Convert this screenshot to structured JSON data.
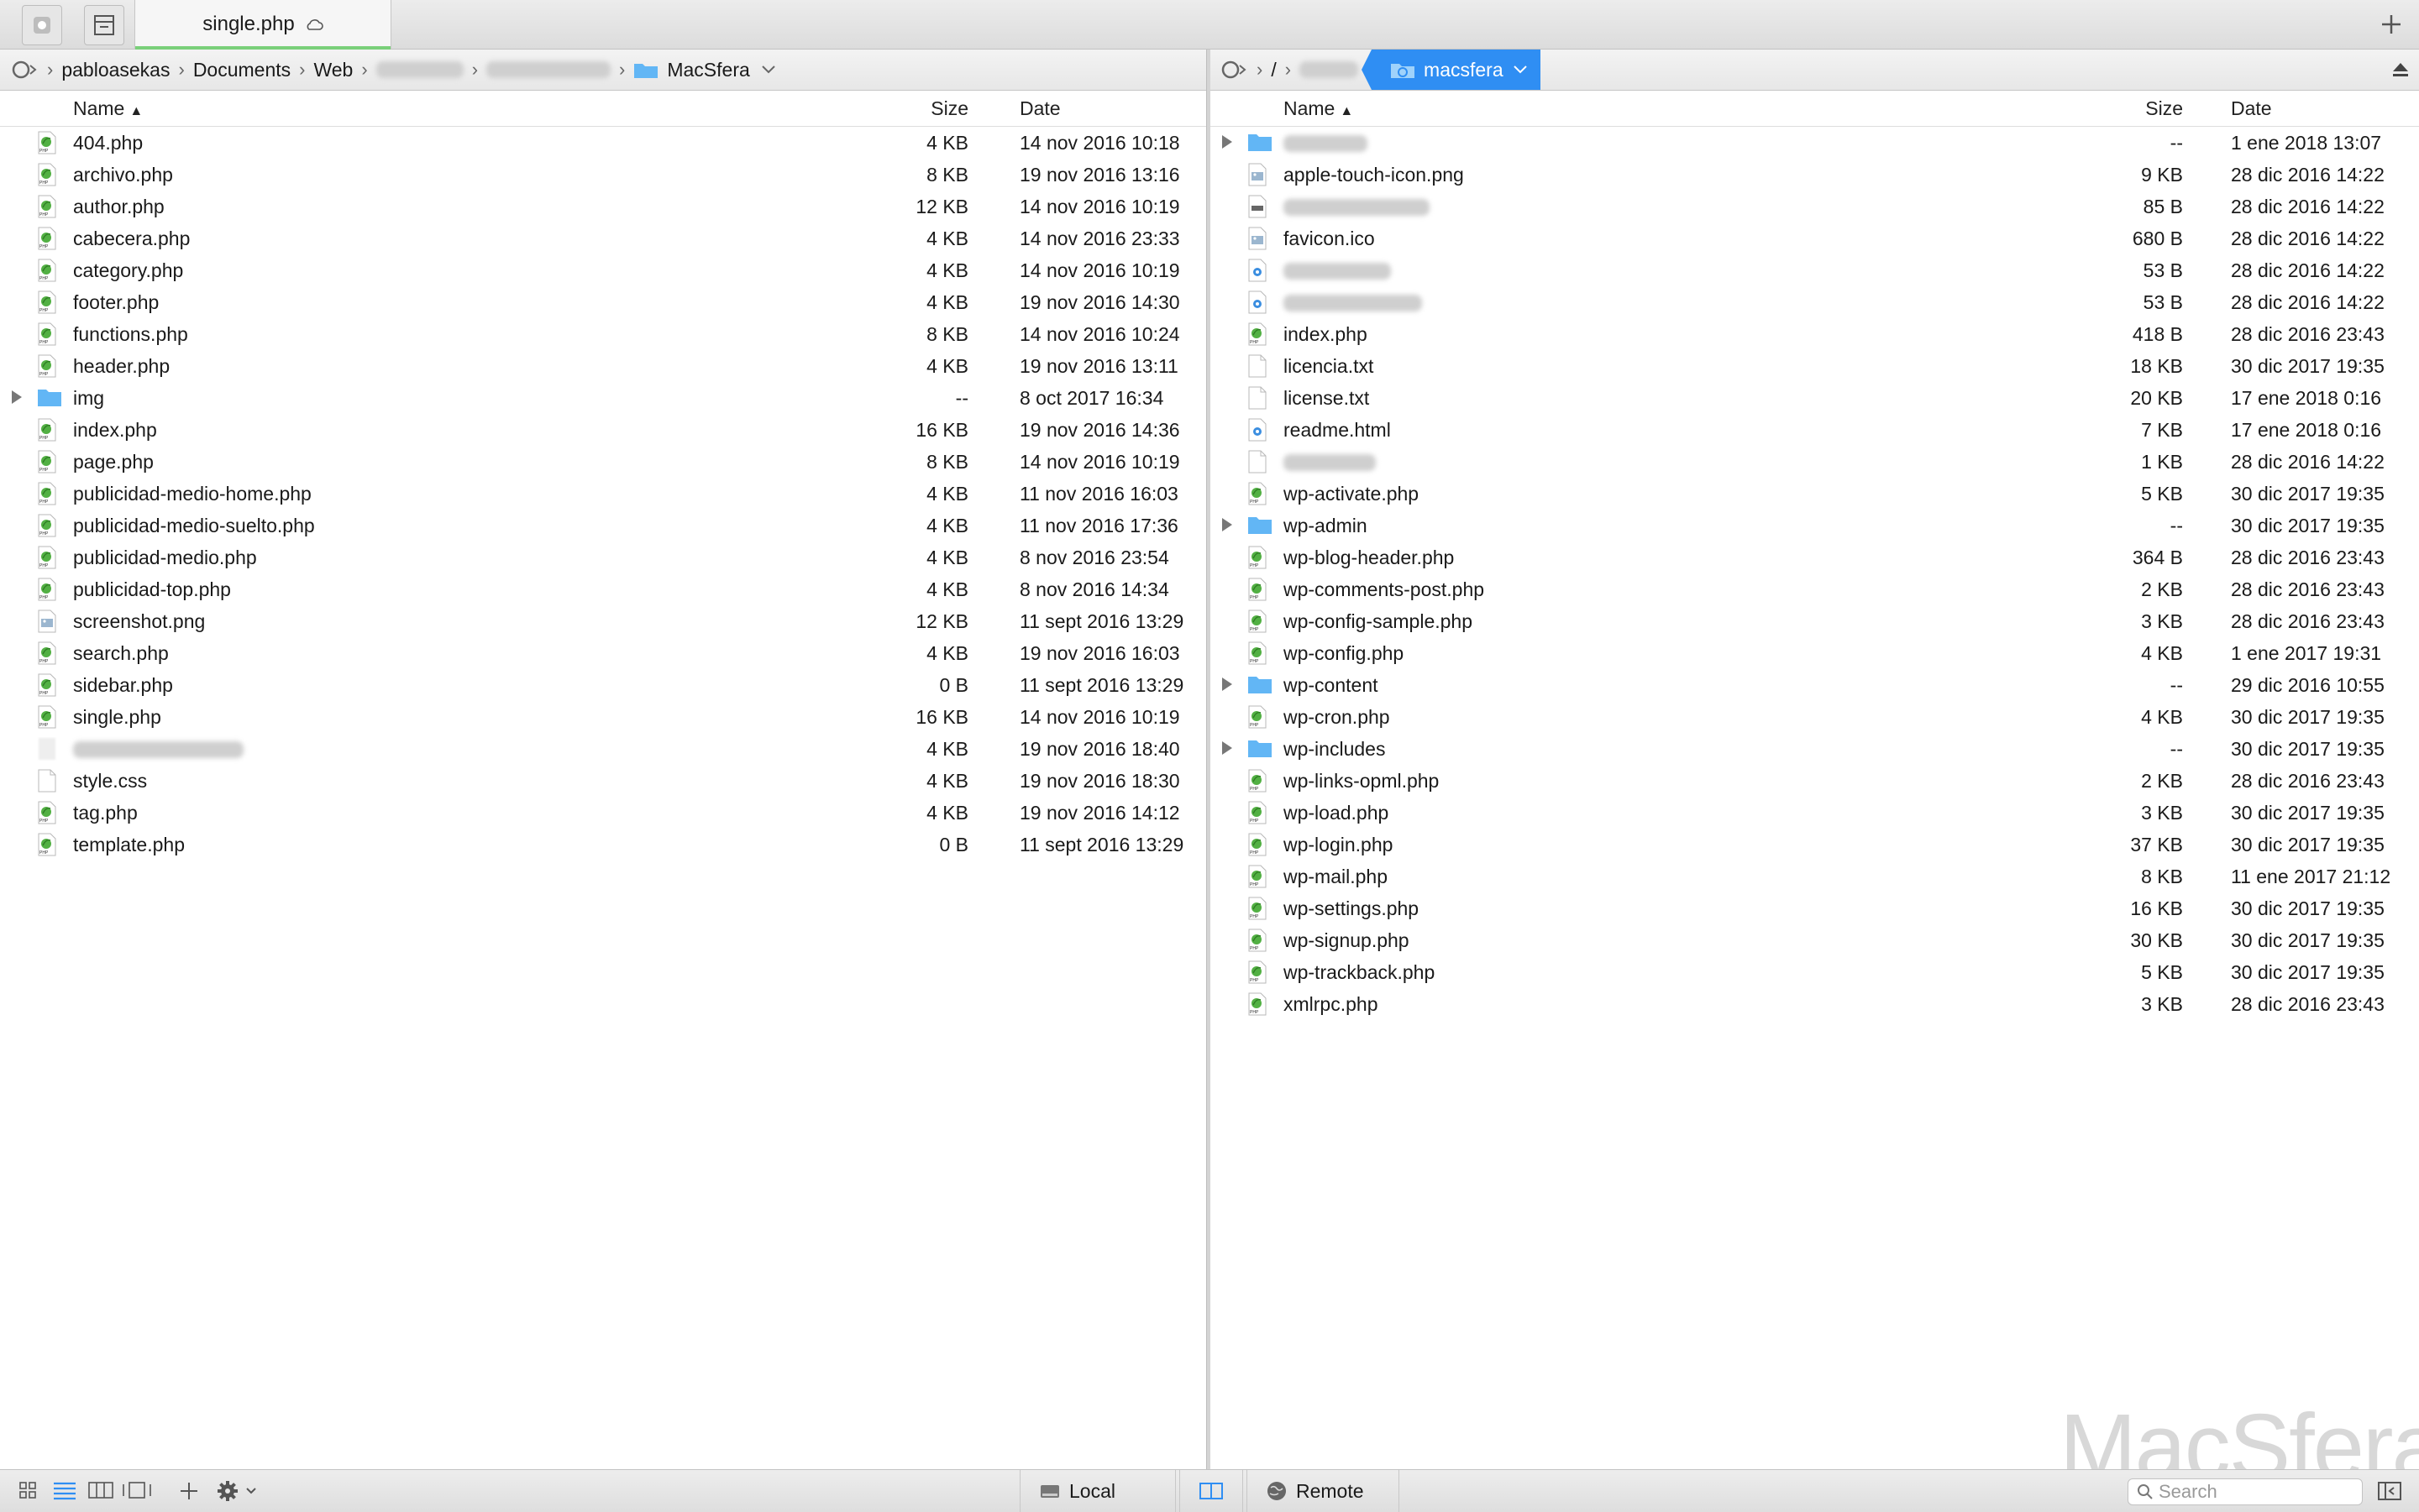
{
  "tab": {
    "title": "single.php"
  },
  "left_path": {
    "crumbs": [
      "pabloasekas",
      "Documents",
      "Web"
    ],
    "folder": "MacSfera"
  },
  "right_path": {
    "root": "/",
    "folder": "macsfera"
  },
  "columns": {
    "name": "Name",
    "size": "Size",
    "date": "Date"
  },
  "left_files": [
    {
      "name": "404.php",
      "size": "4 KB",
      "date": "14 nov 2016 10:18",
      "type": "php"
    },
    {
      "name": "archivo.php",
      "size": "8 KB",
      "date": "19 nov 2016 13:16",
      "type": "php"
    },
    {
      "name": "author.php",
      "size": "12 KB",
      "date": "14 nov 2016 10:19",
      "type": "php"
    },
    {
      "name": "cabecera.php",
      "size": "4 KB",
      "date": "14 nov 2016 23:33",
      "type": "php"
    },
    {
      "name": "category.php",
      "size": "4 KB",
      "date": "14 nov 2016 10:19",
      "type": "php"
    },
    {
      "name": "footer.php",
      "size": "4 KB",
      "date": "19 nov 2016 14:30",
      "type": "php"
    },
    {
      "name": "functions.php",
      "size": "8 KB",
      "date": "14 nov 2016 10:24",
      "type": "php"
    },
    {
      "name": "header.php",
      "size": "4 KB",
      "date": "19 nov 2016 13:11",
      "type": "php"
    },
    {
      "name": "img",
      "size": "--",
      "date": "8 oct 2017 16:34",
      "type": "folder"
    },
    {
      "name": "index.php",
      "size": "16 KB",
      "date": "19 nov 2016 14:36",
      "type": "php"
    },
    {
      "name": "page.php",
      "size": "8 KB",
      "date": "14 nov 2016 10:19",
      "type": "php"
    },
    {
      "name": "publicidad-medio-home.php",
      "size": "4 KB",
      "date": "11 nov 2016 16:03",
      "type": "php"
    },
    {
      "name": "publicidad-medio-suelto.php",
      "size": "4 KB",
      "date": "11 nov 2016 17:36",
      "type": "php"
    },
    {
      "name": "publicidad-medio.php",
      "size": "4 KB",
      "date": "8 nov 2016 23:54",
      "type": "php"
    },
    {
      "name": "publicidad-top.php",
      "size": "4 KB",
      "date": "8 nov 2016 14:34",
      "type": "php"
    },
    {
      "name": "screenshot.png",
      "size": "12 KB",
      "date": "11 sept 2016 13:29",
      "type": "image"
    },
    {
      "name": "search.php",
      "size": "4 KB",
      "date": "19 nov 2016 16:03",
      "type": "php"
    },
    {
      "name": "sidebar.php",
      "size": "0 B",
      "date": "11 sept 2016 13:29",
      "type": "php"
    },
    {
      "name": "single.php",
      "size": "16 KB",
      "date": "14 nov 2016 10:19",
      "type": "php"
    },
    {
      "name": "",
      "size": "4 KB",
      "date": "19 nov 2016 18:40",
      "type": "blank",
      "blurred": true
    },
    {
      "name": "style.css",
      "size": "4 KB",
      "date": "19 nov 2016 18:30",
      "type": "text"
    },
    {
      "name": "tag.php",
      "size": "4 KB",
      "date": "19 nov 2016 14:12",
      "type": "php"
    },
    {
      "name": "template.php",
      "size": "0 B",
      "date": "11 sept 2016 13:29",
      "type": "php"
    }
  ],
  "right_files": [
    {
      "name": "",
      "size": "--",
      "date": "1 ene 2018 13:07",
      "type": "folder",
      "blurred": true
    },
    {
      "name": "apple-touch-icon.png",
      "size": "9 KB",
      "date": "28 dic 2016 14:22",
      "type": "image"
    },
    {
      "name": "",
      "size": "85 B",
      "date": "28 dic 2016 14:22",
      "type": "txt",
      "blurred": true
    },
    {
      "name": "favicon.ico",
      "size": "680 B",
      "date": "28 dic 2016 14:22",
      "type": "image"
    },
    {
      "name": "",
      "size": "53 B",
      "date": "28 dic 2016 14:22",
      "type": "html",
      "blurred": true
    },
    {
      "name": "",
      "size": "53 B",
      "date": "28 dic 2016 14:22",
      "type": "html",
      "blurred": true
    },
    {
      "name": "index.php",
      "size": "418 B",
      "date": "28 dic 2016 23:43",
      "type": "php"
    },
    {
      "name": "licencia.txt",
      "size": "18 KB",
      "date": "30 dic 2017 19:35",
      "type": "text"
    },
    {
      "name": "license.txt",
      "size": "20 KB",
      "date": "17 ene 2018 0:16",
      "type": "text"
    },
    {
      "name": "readme.html",
      "size": "7 KB",
      "date": "17 ene 2018 0:16",
      "type": "html"
    },
    {
      "name": "",
      "size": "1 KB",
      "date": "28 dic 2016 14:22",
      "type": "text",
      "blurred": true
    },
    {
      "name": "wp-activate.php",
      "size": "5 KB",
      "date": "30 dic 2017 19:35",
      "type": "php"
    },
    {
      "name": "wp-admin",
      "size": "--",
      "date": "30 dic 2017 19:35",
      "type": "folder"
    },
    {
      "name": "wp-blog-header.php",
      "size": "364 B",
      "date": "28 dic 2016 23:43",
      "type": "php"
    },
    {
      "name": "wp-comments-post.php",
      "size": "2 KB",
      "date": "28 dic 2016 23:43",
      "type": "php"
    },
    {
      "name": "wp-config-sample.php",
      "size": "3 KB",
      "date": "28 dic 2016 23:43",
      "type": "php"
    },
    {
      "name": "wp-config.php",
      "size": "4 KB",
      "date": "1 ene 2017 19:31",
      "type": "php"
    },
    {
      "name": "wp-content",
      "size": "--",
      "date": "29 dic 2016 10:55",
      "type": "folder"
    },
    {
      "name": "wp-cron.php",
      "size": "4 KB",
      "date": "30 dic 2017 19:35",
      "type": "php"
    },
    {
      "name": "wp-includes",
      "size": "--",
      "date": "30 dic 2017 19:35",
      "type": "folder"
    },
    {
      "name": "wp-links-opml.php",
      "size": "2 KB",
      "date": "28 dic 2016 23:43",
      "type": "php"
    },
    {
      "name": "wp-load.php",
      "size": "3 KB",
      "date": "30 dic 2017 19:35",
      "type": "php"
    },
    {
      "name": "wp-login.php",
      "size": "37 KB",
      "date": "30 dic 2017 19:35",
      "type": "php"
    },
    {
      "name": "wp-mail.php",
      "size": "8 KB",
      "date": "11 ene 2017 21:12",
      "type": "php"
    },
    {
      "name": "wp-settings.php",
      "size": "16 KB",
      "date": "30 dic 2017 19:35",
      "type": "php"
    },
    {
      "name": "wp-signup.php",
      "size": "30 KB",
      "date": "30 dic 2017 19:35",
      "type": "php"
    },
    {
      "name": "wp-trackback.php",
      "size": "5 KB",
      "date": "30 dic 2017 19:35",
      "type": "php"
    },
    {
      "name": "xmlrpc.php",
      "size": "3 KB",
      "date": "28 dic 2016 23:43",
      "type": "php"
    }
  ],
  "bottom": {
    "local_label": "Local",
    "remote_label": "Remote",
    "search_placeholder": "Search"
  },
  "watermark": "MacSfera",
  "colors": {
    "accent": "#2f8ef3",
    "folder": "#62b6f5",
    "php": "#52b043",
    "tab_underline": "#7ad07a"
  }
}
